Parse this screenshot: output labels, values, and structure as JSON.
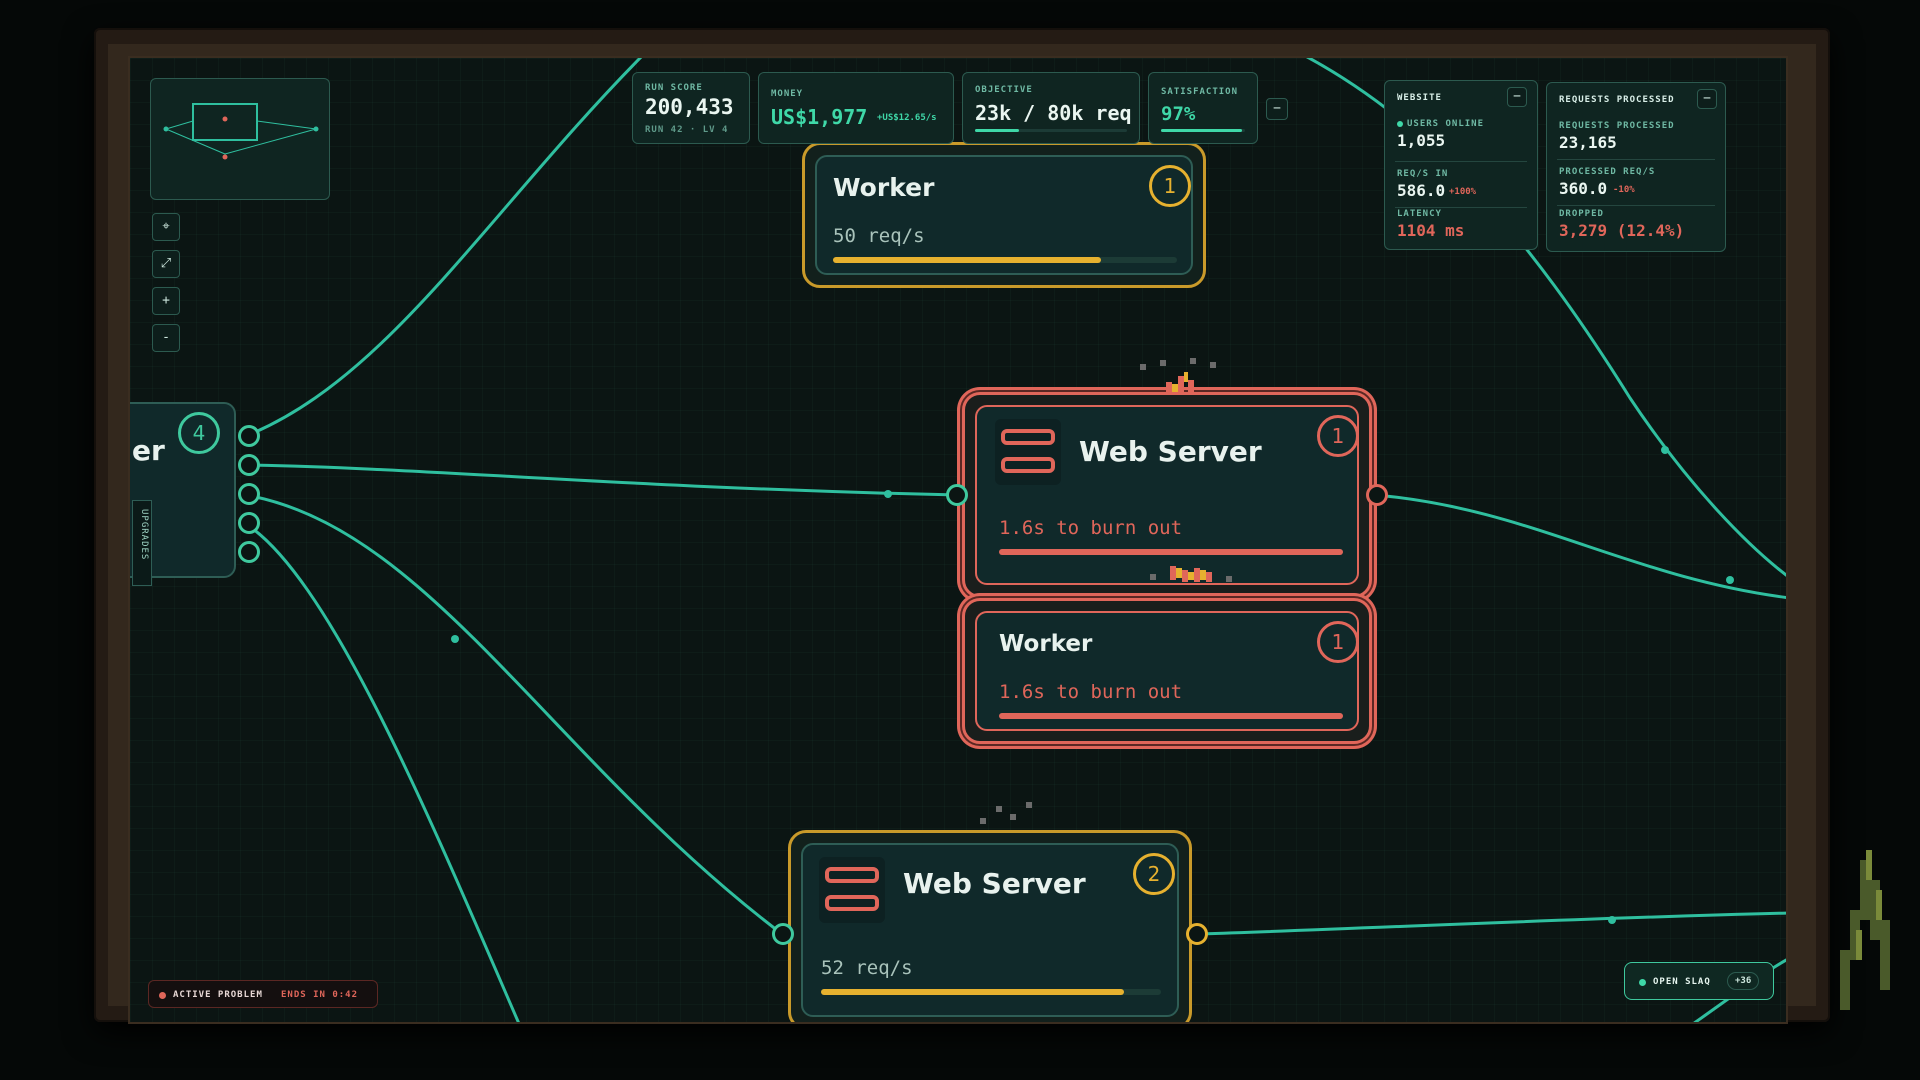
{
  "hud": {
    "run_score": {
      "label": "RUN SCORE",
      "value": "200,433",
      "sub": "RUN 42 · LV 4"
    },
    "money": {
      "label": "MONEY",
      "value": "US$1,977",
      "rate": "+US$12.65/s"
    },
    "objective": {
      "label": "OBJECTIVE",
      "value": "23k / 80k req",
      "progress": 0.29
    },
    "satisfaction": {
      "label": "SATISFACTION",
      "value": "97%",
      "progress": 0.97
    },
    "collapse": "−"
  },
  "website_panel": {
    "title": "WEBSITE",
    "collapse": "−",
    "users_online_label": "USERS ONLINE",
    "users_online": "1,055",
    "reqs_in_label": "REQ/S IN",
    "reqs_in": "586.0",
    "reqs_in_delta": "+100%",
    "latency_label": "LATENCY",
    "latency": "1104 ms"
  },
  "requests_panel": {
    "title": "REQUESTS PROCESSED",
    "collapse": "−",
    "processed_label": "REQUESTS PROCESSED",
    "processed": "23,165",
    "processed_rate_label": "PROCESSED REQ/S",
    "processed_rate": "360.0",
    "processed_rate_delta": "-10%",
    "dropped_label": "DROPPED",
    "dropped": "3,279 (12.4%)"
  },
  "zoom_controls": {
    "fit": "⌖",
    "expand": "⤢",
    "zoom_in": "+",
    "zoom_out": "-"
  },
  "nodes": {
    "worker_top": {
      "title": "Worker",
      "badge": "1",
      "status": "50 req/s",
      "progress": 0.78
    },
    "web_server_mid": {
      "title": "Web Server",
      "badge": "1",
      "status": "1.6s to burn out",
      "progress": 1.0
    },
    "worker_mid": {
      "title": "Worker",
      "badge": "1",
      "status": "1.6s to burn out",
      "progress": 1.0
    },
    "web_server_bottom": {
      "title": "Web Server",
      "badge": "2",
      "status": "52 req/s",
      "progress": 0.89
    },
    "left_node": {
      "title_fragment": "er",
      "badge": "4",
      "side_tab": "UPGRADES"
    }
  },
  "alerts": {
    "active_problem": "ACTIVE PROBLEM",
    "ends_in": "ENDS IN 0:42"
  },
  "slaq_button": {
    "label": "OPEN SLAQ",
    "count": "+36"
  },
  "colors": {
    "wire": "#2fbf9f",
    "gold": "#e6b12f",
    "danger": "#e0665a",
    "bg": "#0b1513"
  }
}
